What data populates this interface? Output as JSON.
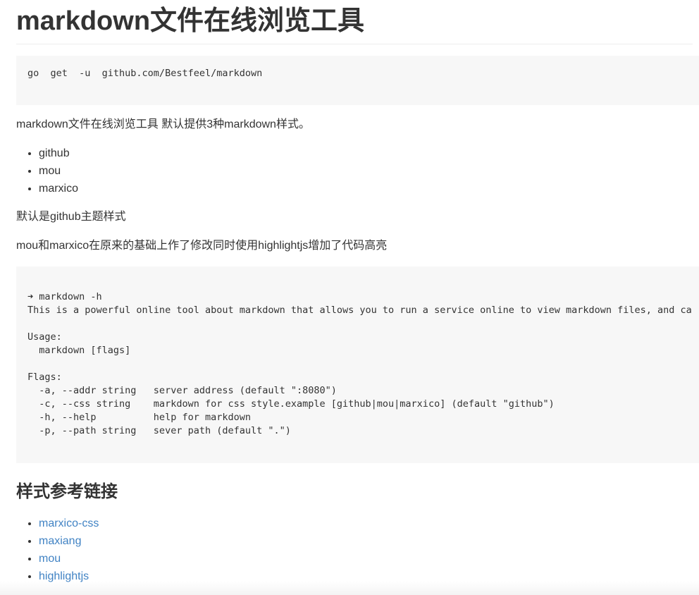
{
  "doc": {
    "title": "markdown文件在线浏览工具",
    "install_command": "go  get  -u  github.com/Bestfeel/markdown",
    "intro": "markdown文件在线浏览工具 默认提供3种markdown样式。",
    "styles": [
      "github",
      "mou",
      "marxico"
    ],
    "default_note": "默认是github主题样式",
    "modify_note": "mou和marxico在原来的基础上作了修改同时使用highlightjs增加了代码高亮",
    "help_output": "➜ markdown -h\nThis is a powerful online tool about markdown that allows you to run a service online to view markdown files, and ca\n\nUsage:\n  markdown [flags]\n\nFlags:\n  -a, --addr string   server address (default \":8080\")\n  -c, --css string    markdown for css style.example [github|mou|marxico] (default \"github\")\n  -h, --help          help for markdown\n  -p, --path string   sever path (default \".\")",
    "refs_heading": "样式参考链接",
    "links": [
      "marxico-css",
      "maxiang",
      "mou",
      "highlightjs"
    ],
    "link_color": "#4183c4",
    "code_bg": "#f7f7f7"
  }
}
